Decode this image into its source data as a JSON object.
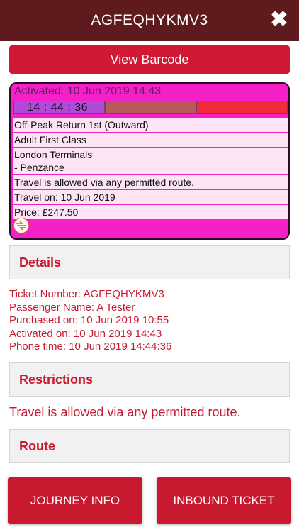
{
  "header": {
    "title": "AGFEQHYKMV3",
    "close_icon": "close-icon"
  },
  "view_barcode": {
    "label": "View Barcode"
  },
  "ticket": {
    "activated": "Activated: 10 Jun 2019 14:43",
    "timer": "14 : 44 : 36",
    "lines": [
      "Off-Peak Return 1st (Outward)",
      "Adult First Class"
    ],
    "route_line1": "London Terminals",
    "route_line2": "- Penzance",
    "validity": "Travel is allowed via any permitted route.",
    "travel_on": "Travel on: 10 Jun 2019",
    "price": "Price: £247.50",
    "icon": "national-rail-icon",
    "colors": {
      "background": "#f421c9",
      "rows": "#fde5f5",
      "timer": "#b04bd9",
      "alert": "#f22b38"
    }
  },
  "details": {
    "title": "Details",
    "ticket_number": "Ticket Number: AGFEQHYKMV3",
    "passenger": "Passenger Name: A Tester",
    "purchased": "Purchased on: 10 Jun 2019 10:55",
    "activated": "Activated on: 10 Jun 2019 14:43",
    "phone_time": "Phone time: 10 Jun 2019 14:44:36"
  },
  "restrictions": {
    "title": "Restrictions",
    "text": "Travel is allowed via any permitted route."
  },
  "route": {
    "title": "Route"
  },
  "buttons": {
    "journey_info": "JOURNEY INFO",
    "inbound_ticket": "INBOUND TICKET"
  },
  "colors": {
    "header": "#5e1a1d",
    "accent": "#c9192f",
    "button": "#d01a34"
  }
}
